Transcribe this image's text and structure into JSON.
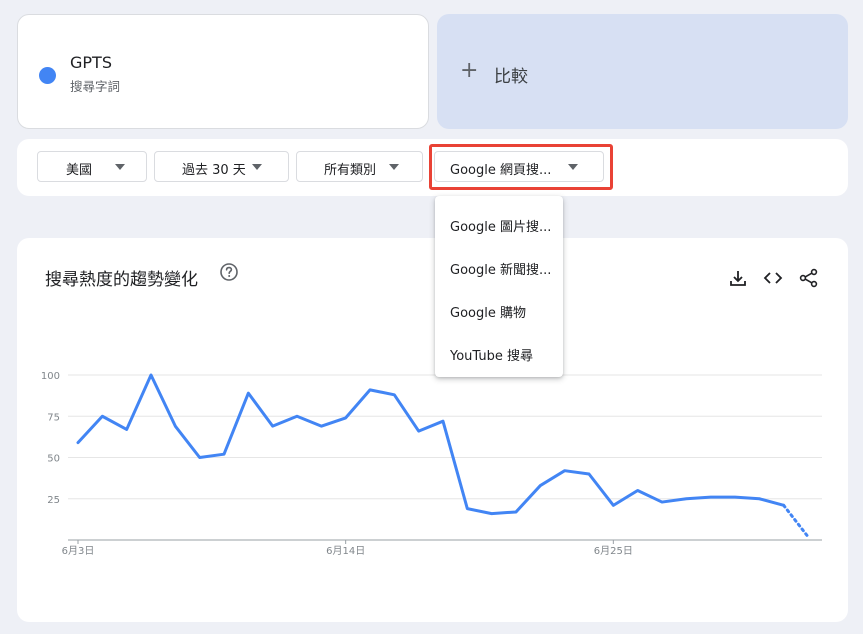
{
  "search_term": {
    "name": "GPTS",
    "type": "搜尋字詞",
    "color": "#4285f4"
  },
  "compare": {
    "icon": "plus-icon",
    "label": "比較"
  },
  "filters": {
    "geo": "美國",
    "time": "過去 30 天",
    "category": "所有類別",
    "property": "Google 網頁搜..."
  },
  "property_menu": {
    "items": [
      "Google 圖片搜...",
      "Google 新聞搜...",
      "Google 購物",
      "YouTube 搜尋"
    ]
  },
  "interest_panel": {
    "title": "搜尋熱度的趨勢變化",
    "icons": [
      "help-icon",
      "download-icon",
      "embed-code-icon",
      "share-icon"
    ]
  },
  "highlight_color": "#e94235",
  "chart_data": {
    "type": "line",
    "title": "",
    "xlabel": "",
    "ylabel": "",
    "ylim": [
      0,
      100
    ],
    "yticks": [
      25,
      50,
      75,
      100
    ],
    "x_tick_labels": [
      "6月3日",
      "6月14日",
      "6月25日"
    ],
    "x_tick_indices": [
      0,
      11,
      22
    ],
    "grid": true,
    "series": [
      {
        "color": "#4285f4",
        "values": [
          59,
          75,
          67,
          100,
          69,
          50,
          52,
          89,
          69,
          75,
          69,
          74,
          91,
          88,
          66,
          72,
          19,
          16,
          17,
          33,
          42,
          40,
          21,
          30,
          23,
          25,
          26,
          26,
          25,
          21,
          2
        ],
        "partial_from_index": 29
      }
    ]
  }
}
